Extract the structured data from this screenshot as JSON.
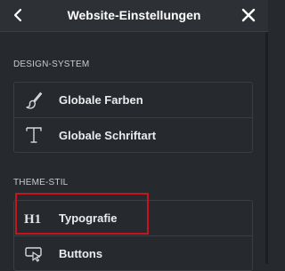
{
  "header": {
    "title": "Website-Einstellungen",
    "back_icon": "chevron-left-icon",
    "close_icon": "close-icon"
  },
  "sections": [
    {
      "title": "DESIGN-SYSTEM",
      "items": [
        {
          "label": "Globale Farben",
          "icon": "brush-icon"
        },
        {
          "label": "Globale Schriftart",
          "icon": "font-T-icon"
        }
      ]
    },
    {
      "title": "THEME-STIL",
      "items": [
        {
          "label": "Typografie",
          "icon": "heading-H1-icon"
        },
        {
          "label": "Buttons",
          "icon": "button-cursor-icon"
        }
      ]
    }
  ],
  "colors": {
    "background": "#26292d",
    "highlight": "#c8141b"
  }
}
